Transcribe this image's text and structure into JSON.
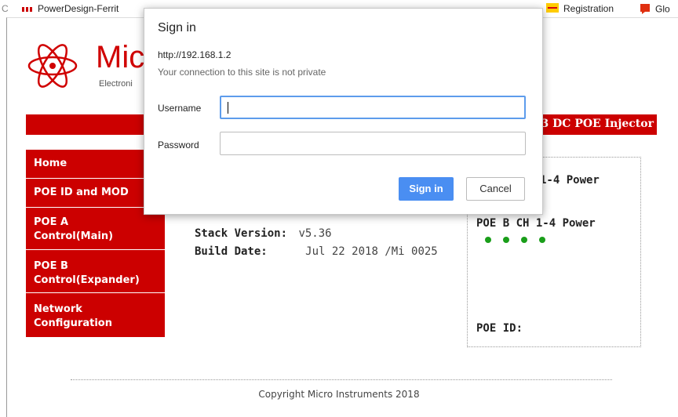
{
  "bookmarks": {
    "items": [
      {
        "label": "C",
        "icon": "bookmark-letter"
      },
      {
        "label": "PowerDesign-Ferrit",
        "icon": "powerdesign-icon"
      },
      {
        "label": "Registration",
        "icon": "dhl-icon"
      },
      {
        "label": "Glo",
        "icon": "red-flag-icon"
      }
    ]
  },
  "page": {
    "logo_text": "Micr",
    "logo_sub": "Electroni",
    "banner_text": "3 DC POE Injector",
    "menu": [
      {
        "label": "Home"
      },
      {
        "label": "POE ID and MOD"
      },
      {
        "label_line1": "POE A",
        "label_line2": "Control(Main)"
      },
      {
        "label_line1": "POE B",
        "label_line2": "Control(Expander)"
      },
      {
        "label_line1": "Network",
        "label_line2": "Configuration"
      }
    ],
    "stack_version_label": "Stack Version:",
    "stack_version_value": "v5.36",
    "build_date_label": "Build Date:",
    "build_date_value": "Jul 22 2018 /Mi 0025",
    "poe_a_power_label": "1-4 Power",
    "poe_b_power_label": "POE B CH 1-4 Power",
    "poe_id_label": "POE ID:",
    "footer": "Copyright Micro Instruments 2018",
    "status_color": "#1a9e1a",
    "brand_red": "#cc0000"
  },
  "dialog": {
    "title": "Sign in",
    "url": "http://192.168.1.2",
    "warning": "Your connection to this site is not private",
    "username_label": "Username",
    "username_value": "",
    "password_label": "Password",
    "password_value": "",
    "signin_label": "Sign in",
    "cancel_label": "Cancel",
    "accent": "#4a8ef2"
  }
}
